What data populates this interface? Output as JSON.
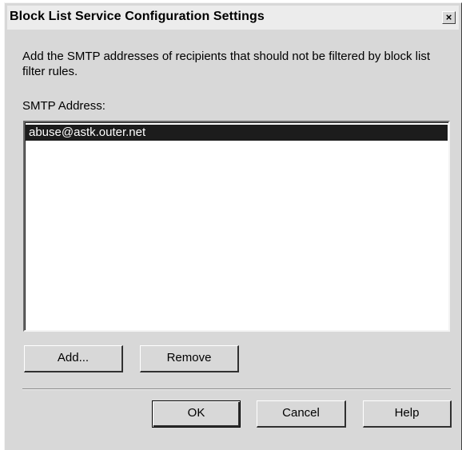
{
  "window": {
    "title": "Block List Service Configuration Settings",
    "close_glyph": "×"
  },
  "description": "Add the SMTP addresses of recipients that should not be filtered by block list filter rules.",
  "smtp": {
    "label": "SMTP Address:",
    "addresses": [
      "abuse@astk.outer.net"
    ],
    "selected_index": 0
  },
  "list_buttons": {
    "add": "Add...",
    "remove": "Remove"
  },
  "footer_buttons": {
    "ok": "OK",
    "cancel": "Cancel",
    "help": "Help"
  },
  "colors": {
    "dialog_bg": "#d8d8d8",
    "titlebar_bg": "#ececec",
    "selection_bg": "#1c1c1c",
    "selection_fg": "#ffffff"
  }
}
